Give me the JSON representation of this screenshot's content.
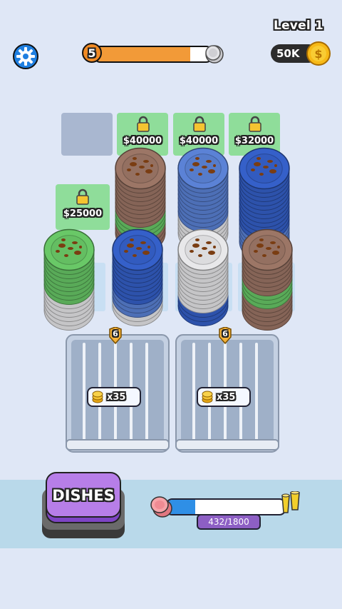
{
  "hud": {
    "level_label": "Level 1",
    "level_number": "5",
    "level_progress": 0.82,
    "money": "50K"
  },
  "board": {
    "locks": [
      {
        "price": "$40000"
      },
      {
        "price": "$40000"
      },
      {
        "price": "$32000"
      },
      {
        "price": "$25000"
      }
    ]
  },
  "racks": [
    {
      "capacity": "6",
      "reward": "x35"
    },
    {
      "capacity": "6",
      "reward": "x35"
    }
  ],
  "bottom": {
    "dishes_button": "DISHES",
    "wash_count": "432/1800",
    "wash_progress": 0.24
  },
  "colors": {
    "brown": "#9c7666",
    "blue": "#5b82d6",
    "white": "#e8e8ea",
    "green": "#69c867",
    "sky": "#6aa3e0",
    "navy": "#3560c9"
  }
}
